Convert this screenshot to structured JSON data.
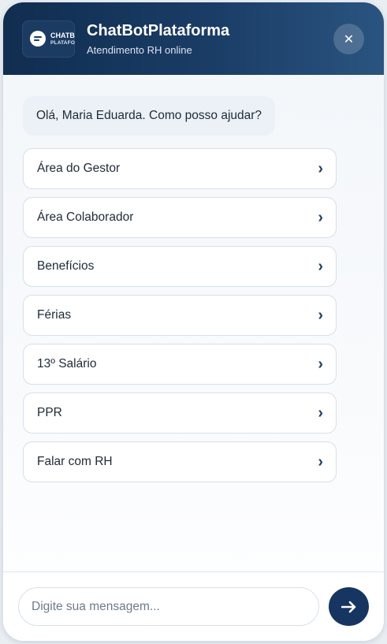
{
  "header": {
    "logo_line1": "CHATBOT",
    "logo_line2": "PLATAFORMA",
    "title": "ChatBotPlataforma",
    "subtitle": "Atendimento RH online",
    "close_label": "✕"
  },
  "conversation": {
    "greeting": "Olá, Maria Eduarda. Como posso ajudar?"
  },
  "options": [
    {
      "label": "Área do Gestor",
      "chevron": "›"
    },
    {
      "label": "Área Colaborador",
      "chevron": "›"
    },
    {
      "label": "Benefícios",
      "chevron": "›"
    },
    {
      "label": "Férias",
      "chevron": "›"
    },
    {
      "label": "13º Salário",
      "chevron": "›"
    },
    {
      "label": "PPR",
      "chevron": "›"
    },
    {
      "label": "Falar com RH",
      "chevron": "›"
    }
  ],
  "composer": {
    "placeholder": "Digite sua mensagem...",
    "value": ""
  },
  "icons": {
    "logo": "chat-logo-icon",
    "close": "close-icon",
    "send": "arrow-right-icon",
    "chevron": "chevron-right-icon"
  },
  "colors": {
    "header": "#112d50",
    "accent": "#163560",
    "chevron": "#1e3f66"
  }
}
